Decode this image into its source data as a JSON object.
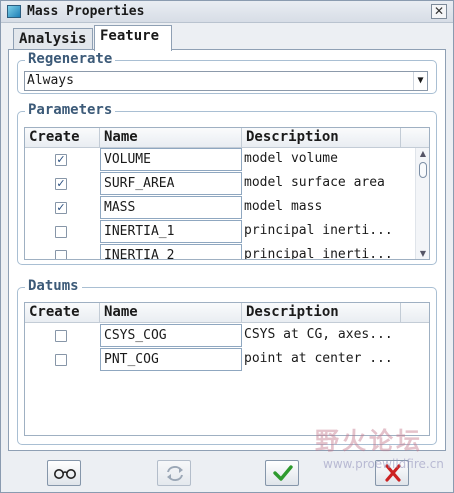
{
  "window": {
    "title": "Mass Properties",
    "close_glyph": "✕"
  },
  "tabs": [
    {
      "label": "Analysis",
      "active": false
    },
    {
      "label": "Feature",
      "active": true
    }
  ],
  "regenerate": {
    "legend": "Regenerate",
    "selected": "Always"
  },
  "parameters": {
    "legend": "Parameters",
    "columns": [
      "Create",
      "Name",
      "Description"
    ],
    "rows": [
      {
        "checked": true,
        "name": "VOLUME",
        "description": "model volume"
      },
      {
        "checked": true,
        "name": "SURF_AREA",
        "description": "model surface area"
      },
      {
        "checked": true,
        "name": "MASS",
        "description": "model mass"
      },
      {
        "checked": false,
        "name": "INERTIA_1",
        "description": "principal inerti..."
      },
      {
        "checked": false,
        "name": "INERTIA_2",
        "description": "principal inerti..."
      }
    ]
  },
  "datums": {
    "legend": "Datums",
    "columns": [
      "Create",
      "Name",
      "Description"
    ],
    "rows": [
      {
        "checked": false,
        "name": "CSYS_COG",
        "description": "CSYS at CG, axes..."
      },
      {
        "checked": false,
        "name": "PNT_COG",
        "description": "point at center ..."
      }
    ]
  },
  "buttons": {
    "preview_icon": "glasses-icon",
    "repeat_icon": "repeat-icon",
    "ok_icon": "checkmark-icon",
    "cancel_icon": "x-icon"
  },
  "watermark": {
    "text_cn": "野火论坛",
    "url": "www.proewildfire.cn"
  },
  "colors": {
    "accent": "#3c5a78",
    "ok": "#2e9a2e",
    "cancel": "#cc2222"
  }
}
